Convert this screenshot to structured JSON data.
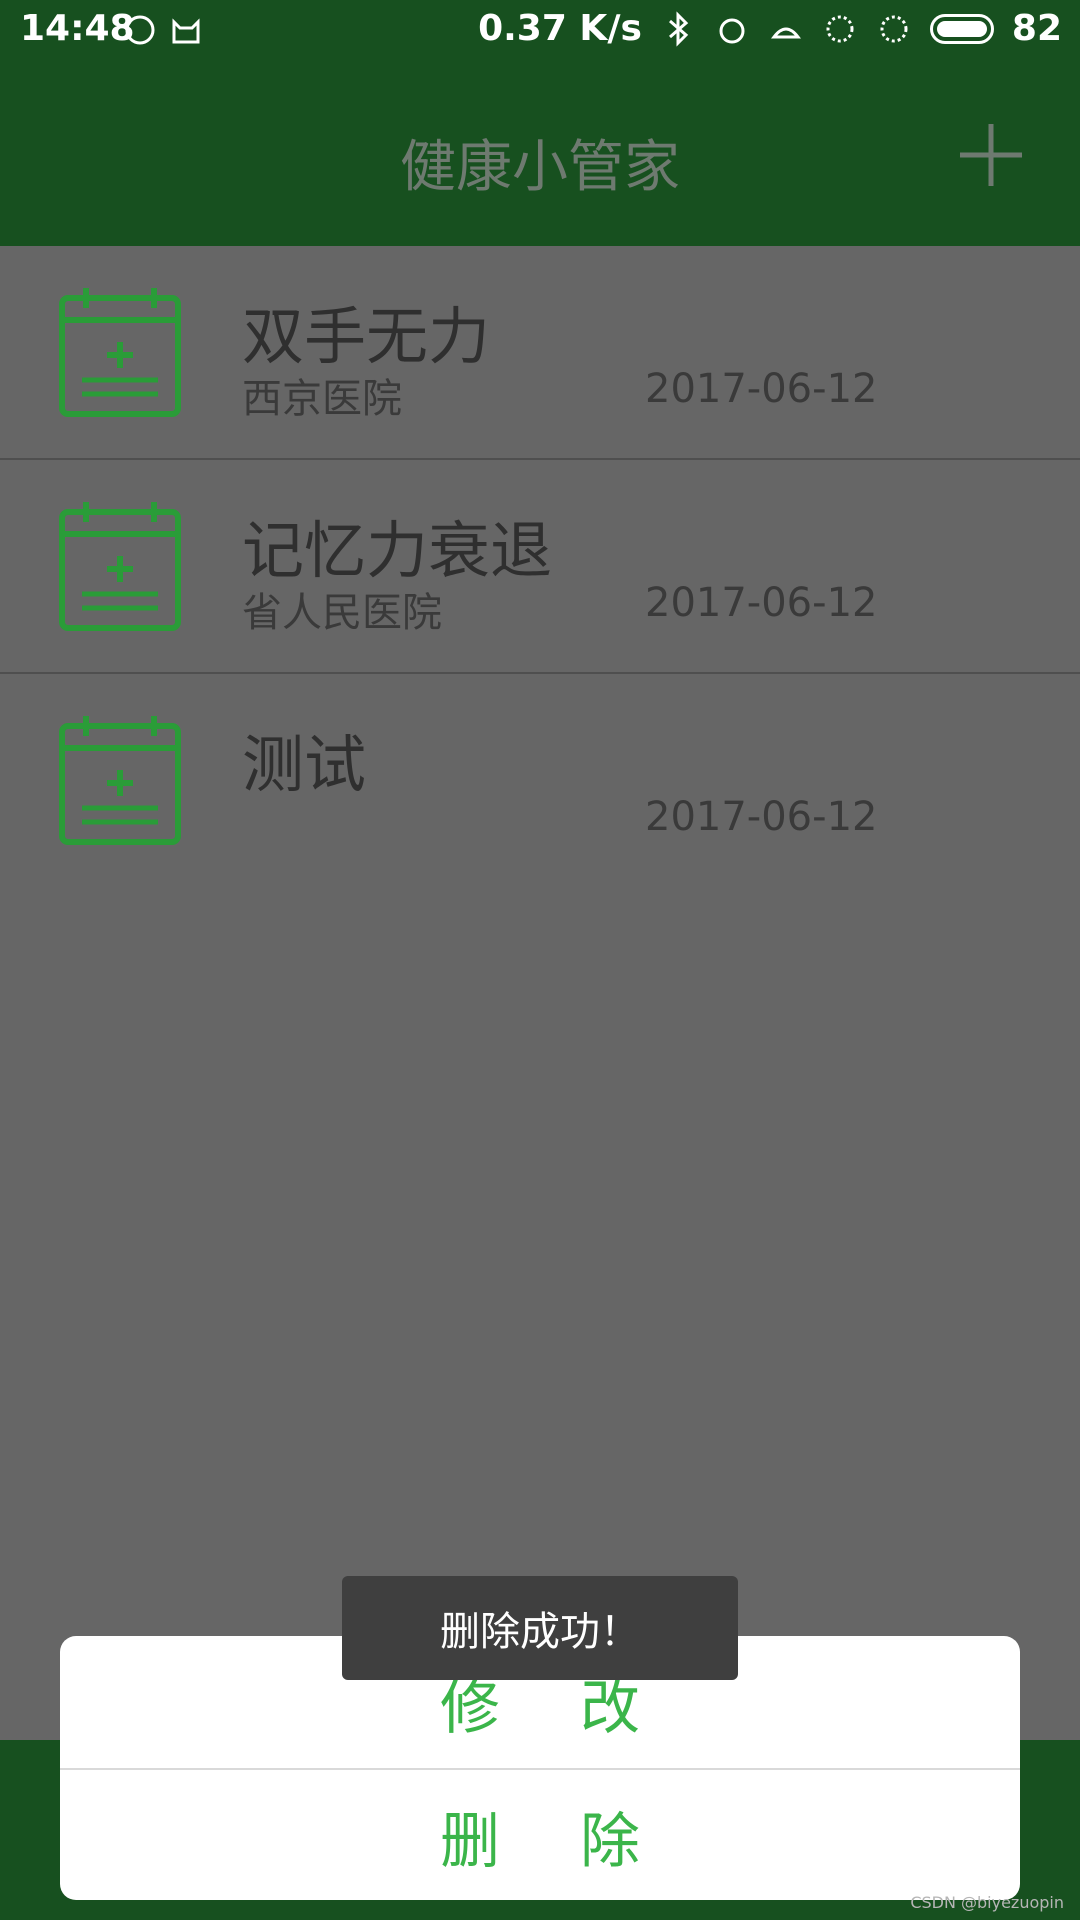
{
  "status": {
    "time": "14:48",
    "speed": "0.37 K/s",
    "battery": "82"
  },
  "appbar": {
    "title": "健康小管家",
    "add_icon": "plus-icon"
  },
  "records": [
    {
      "title": "双手无力",
      "hospital": "西京医院",
      "date": "2017-06-12"
    },
    {
      "title": "记忆力衰退",
      "hospital": "省人民医院",
      "date": "2017-06-12"
    },
    {
      "title": "测试",
      "hospital": "",
      "date": "2017-06-12"
    }
  ],
  "sheet": {
    "edit_label": "修改",
    "delete_label": "删除"
  },
  "toast": {
    "message": "删除成功！"
  },
  "watermark": "CSDN @biyezuopin",
  "colors": {
    "brand_green": "#17501f",
    "accent_green": "#3bb54a",
    "icon_green": "#2a9c38"
  }
}
